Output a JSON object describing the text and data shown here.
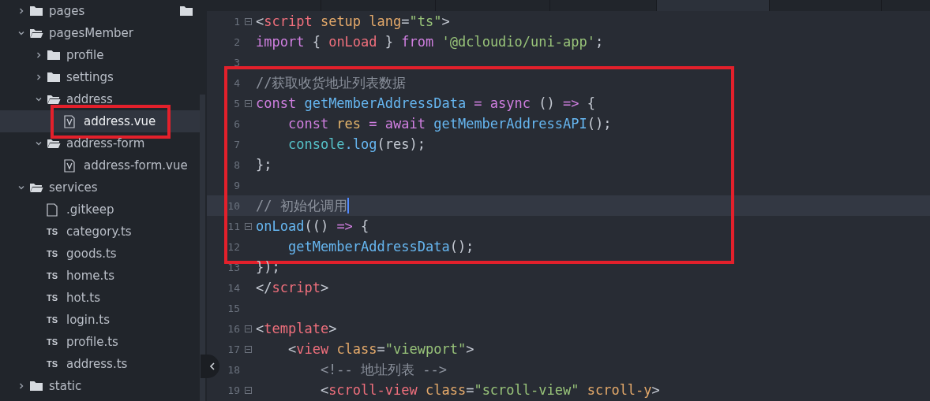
{
  "tabs": [
    {
      "selected": false
    },
    {
      "selected": false
    },
    {
      "selected": false
    },
    {
      "selected": false
    },
    {
      "selected": true
    },
    {
      "selected": false
    },
    {
      "selected": false
    }
  ],
  "explorer": {
    "items": [
      {
        "kind": "folder",
        "name": "pages",
        "expanded": false,
        "selected": false,
        "highlighted": false
      },
      {
        "kind": "folder",
        "name": "pagesMember",
        "expanded": true,
        "selected": false,
        "highlighted": false,
        "children": [
          {
            "kind": "folder",
            "name": "profile",
            "expanded": false,
            "selected": false,
            "highlighted": false
          },
          {
            "kind": "folder",
            "name": "settings",
            "expanded": false,
            "selected": false,
            "highlighted": false
          },
          {
            "kind": "folder",
            "name": "address",
            "expanded": true,
            "selected": false,
            "highlighted": false,
            "children": [
              {
                "kind": "vue",
                "name": "address.vue",
                "selected": true,
                "highlighted": true
              }
            ]
          },
          {
            "kind": "folder",
            "name": "address-form",
            "expanded": true,
            "selected": false,
            "highlighted": false,
            "children": [
              {
                "kind": "vue",
                "name": "address-form.vue",
                "selected": false,
                "highlighted": false
              }
            ]
          }
        ]
      },
      {
        "kind": "folder",
        "name": "services",
        "expanded": true,
        "selected": false,
        "highlighted": false,
        "children": [
          {
            "kind": "file",
            "name": ".gitkeep",
            "selected": false,
            "highlighted": false
          },
          {
            "kind": "ts",
            "icon_text": "TS",
            "name": "category.ts",
            "selected": false,
            "highlighted": false
          },
          {
            "kind": "ts",
            "icon_text": "TS",
            "name": "goods.ts",
            "selected": false,
            "highlighted": false
          },
          {
            "kind": "ts",
            "icon_text": "TS",
            "name": "home.ts",
            "selected": false,
            "highlighted": false
          },
          {
            "kind": "ts",
            "icon_text": "TS",
            "name": "hot.ts",
            "selected": false,
            "highlighted": false
          },
          {
            "kind": "ts",
            "icon_text": "TS",
            "name": "login.ts",
            "selected": false,
            "highlighted": false
          },
          {
            "kind": "ts",
            "icon_text": "TS",
            "name": "profile.ts",
            "selected": false,
            "highlighted": false
          },
          {
            "kind": "ts",
            "icon_text": "TS",
            "name": "address.ts",
            "selected": false,
            "highlighted": false
          }
        ]
      },
      {
        "kind": "folder",
        "name": "static",
        "expanded": false,
        "selected": false,
        "highlighted": false
      }
    ]
  },
  "editor": {
    "blocks": [
      {
        "highlighted": false,
        "lines": [
          {
            "number": "1",
            "foldable": true,
            "current": false,
            "tokens": [
              {
                "kind": "punct",
                "text": "<"
              },
              {
                "kind": "tag",
                "text": "script"
              },
              {
                "kind": "attr",
                "text": " setup lang"
              },
              {
                "kind": "plain",
                "text": "="
              },
              {
                "kind": "str",
                "text": "\"ts\""
              },
              {
                "kind": "punct",
                "text": ">"
              }
            ]
          },
          {
            "number": "2",
            "foldable": false,
            "current": false,
            "tokens": [
              {
                "kind": "kw",
                "text": "import"
              },
              {
                "kind": "plain",
                "text": " { "
              },
              {
                "kind": "tag",
                "text": "onLoad"
              },
              {
                "kind": "plain",
                "text": " } "
              },
              {
                "kind": "kw",
                "text": "from"
              },
              {
                "kind": "str",
                "text": " '@dcloudio/uni-app'"
              },
              {
                "kind": "plain",
                "text": ";"
              }
            ]
          },
          {
            "number": "3",
            "foldable": false,
            "current": false
          }
        ]
      },
      {
        "highlighted": true,
        "lines": [
          {
            "number": "4",
            "foldable": false,
            "current": false,
            "tokens": [
              {
                "kind": "comment",
                "text": "//获取收货地址列表数据"
              }
            ]
          },
          {
            "number": "5",
            "foldable": true,
            "current": false,
            "tokens": [
              {
                "kind": "kw",
                "text": "const"
              },
              {
                "kind": "fn",
                "text": " getMemberAddressData"
              },
              {
                "kind": "kw",
                "text": " = async"
              },
              {
                "kind": "plain",
                "text": " () "
              },
              {
                "kind": "kw",
                "text": "=>"
              },
              {
                "kind": "plain",
                "text": " {"
              }
            ]
          },
          {
            "number": "6",
            "foldable": false,
            "current": false,
            "tokens": [
              {
                "kind": "kw",
                "text": "    const"
              },
              {
                "kind": "var",
                "text": " res"
              },
              {
                "kind": "kw",
                "text": " = await"
              },
              {
                "kind": "fn",
                "text": " getMemberAddressAPI"
              },
              {
                "kind": "plain",
                "text": "();"
              }
            ]
          },
          {
            "number": "7",
            "foldable": false,
            "current": false,
            "tokens": [
              {
                "kind": "builtin",
                "text": "    console"
              },
              {
                "kind": "fn",
                "text": ".log"
              },
              {
                "kind": "plain",
                "text": "(res);"
              }
            ]
          },
          {
            "number": "8",
            "foldable": false,
            "current": false,
            "tokens": [
              {
                "kind": "plain",
                "text": "};"
              }
            ]
          },
          {
            "number": "9",
            "foldable": false,
            "current": false
          },
          {
            "number": "10",
            "foldable": false,
            "current": true,
            "tokens": [
              {
                "kind": "comment",
                "text": "// 初始化调用"
              }
            ]
          },
          {
            "number": "11",
            "foldable": true,
            "current": false,
            "tokens": [
              {
                "kind": "fn",
                "text": "onLoad"
              },
              {
                "kind": "plain",
                "text": "(() "
              },
              {
                "kind": "kw",
                "text": "=>"
              },
              {
                "kind": "plain",
                "text": " {"
              }
            ]
          },
          {
            "number": "12",
            "foldable": false,
            "current": false,
            "tokens": [
              {
                "kind": "fn",
                "text": "    getMemberAddressData"
              },
              {
                "kind": "plain",
                "text": "();"
              }
            ]
          }
        ]
      },
      {
        "highlighted": false,
        "lines": [
          {
            "number": "13",
            "foldable": false,
            "current": false,
            "tokens": [
              {
                "kind": "plain",
                "text": "});"
              }
            ]
          },
          {
            "number": "14",
            "foldable": false,
            "current": false,
            "tokens": [
              {
                "kind": "punct",
                "text": "</"
              },
              {
                "kind": "tag",
                "text": "script"
              },
              {
                "kind": "punct",
                "text": ">"
              }
            ]
          },
          {
            "number": "15",
            "foldable": false,
            "current": false
          },
          {
            "number": "16",
            "foldable": true,
            "current": false,
            "tokens": [
              {
                "kind": "punct",
                "text": "<"
              },
              {
                "kind": "tag",
                "text": "template"
              },
              {
                "kind": "punct",
                "text": ">"
              }
            ]
          },
          {
            "number": "17",
            "foldable": true,
            "current": false,
            "tokens": [
              {
                "kind": "punct",
                "text": "    <"
              },
              {
                "kind": "tag",
                "text": "view"
              },
              {
                "kind": "attr",
                "text": " class"
              },
              {
                "kind": "plain",
                "text": "="
              },
              {
                "kind": "str",
                "text": "\"viewport\""
              },
              {
                "kind": "punct",
                "text": ">"
              }
            ]
          },
          {
            "number": "18",
            "foldable": false,
            "current": false,
            "tokens": [
              {
                "kind": "comment",
                "text": "        <!-- 地址列表 -->"
              }
            ]
          },
          {
            "number": "19",
            "foldable": true,
            "current": false,
            "tokens": [
              {
                "kind": "punct",
                "text": "        <"
              },
              {
                "kind": "tag",
                "text": "scroll-view"
              },
              {
                "kind": "attr",
                "text": " class"
              },
              {
                "kind": "plain",
                "text": "="
              },
              {
                "kind": "str",
                "text": "\"scroll-view\""
              },
              {
                "kind": "attr",
                "text": " scroll-y"
              },
              {
                "kind": "punct",
                "text": ">"
              }
            ]
          }
        ]
      }
    ]
  }
}
